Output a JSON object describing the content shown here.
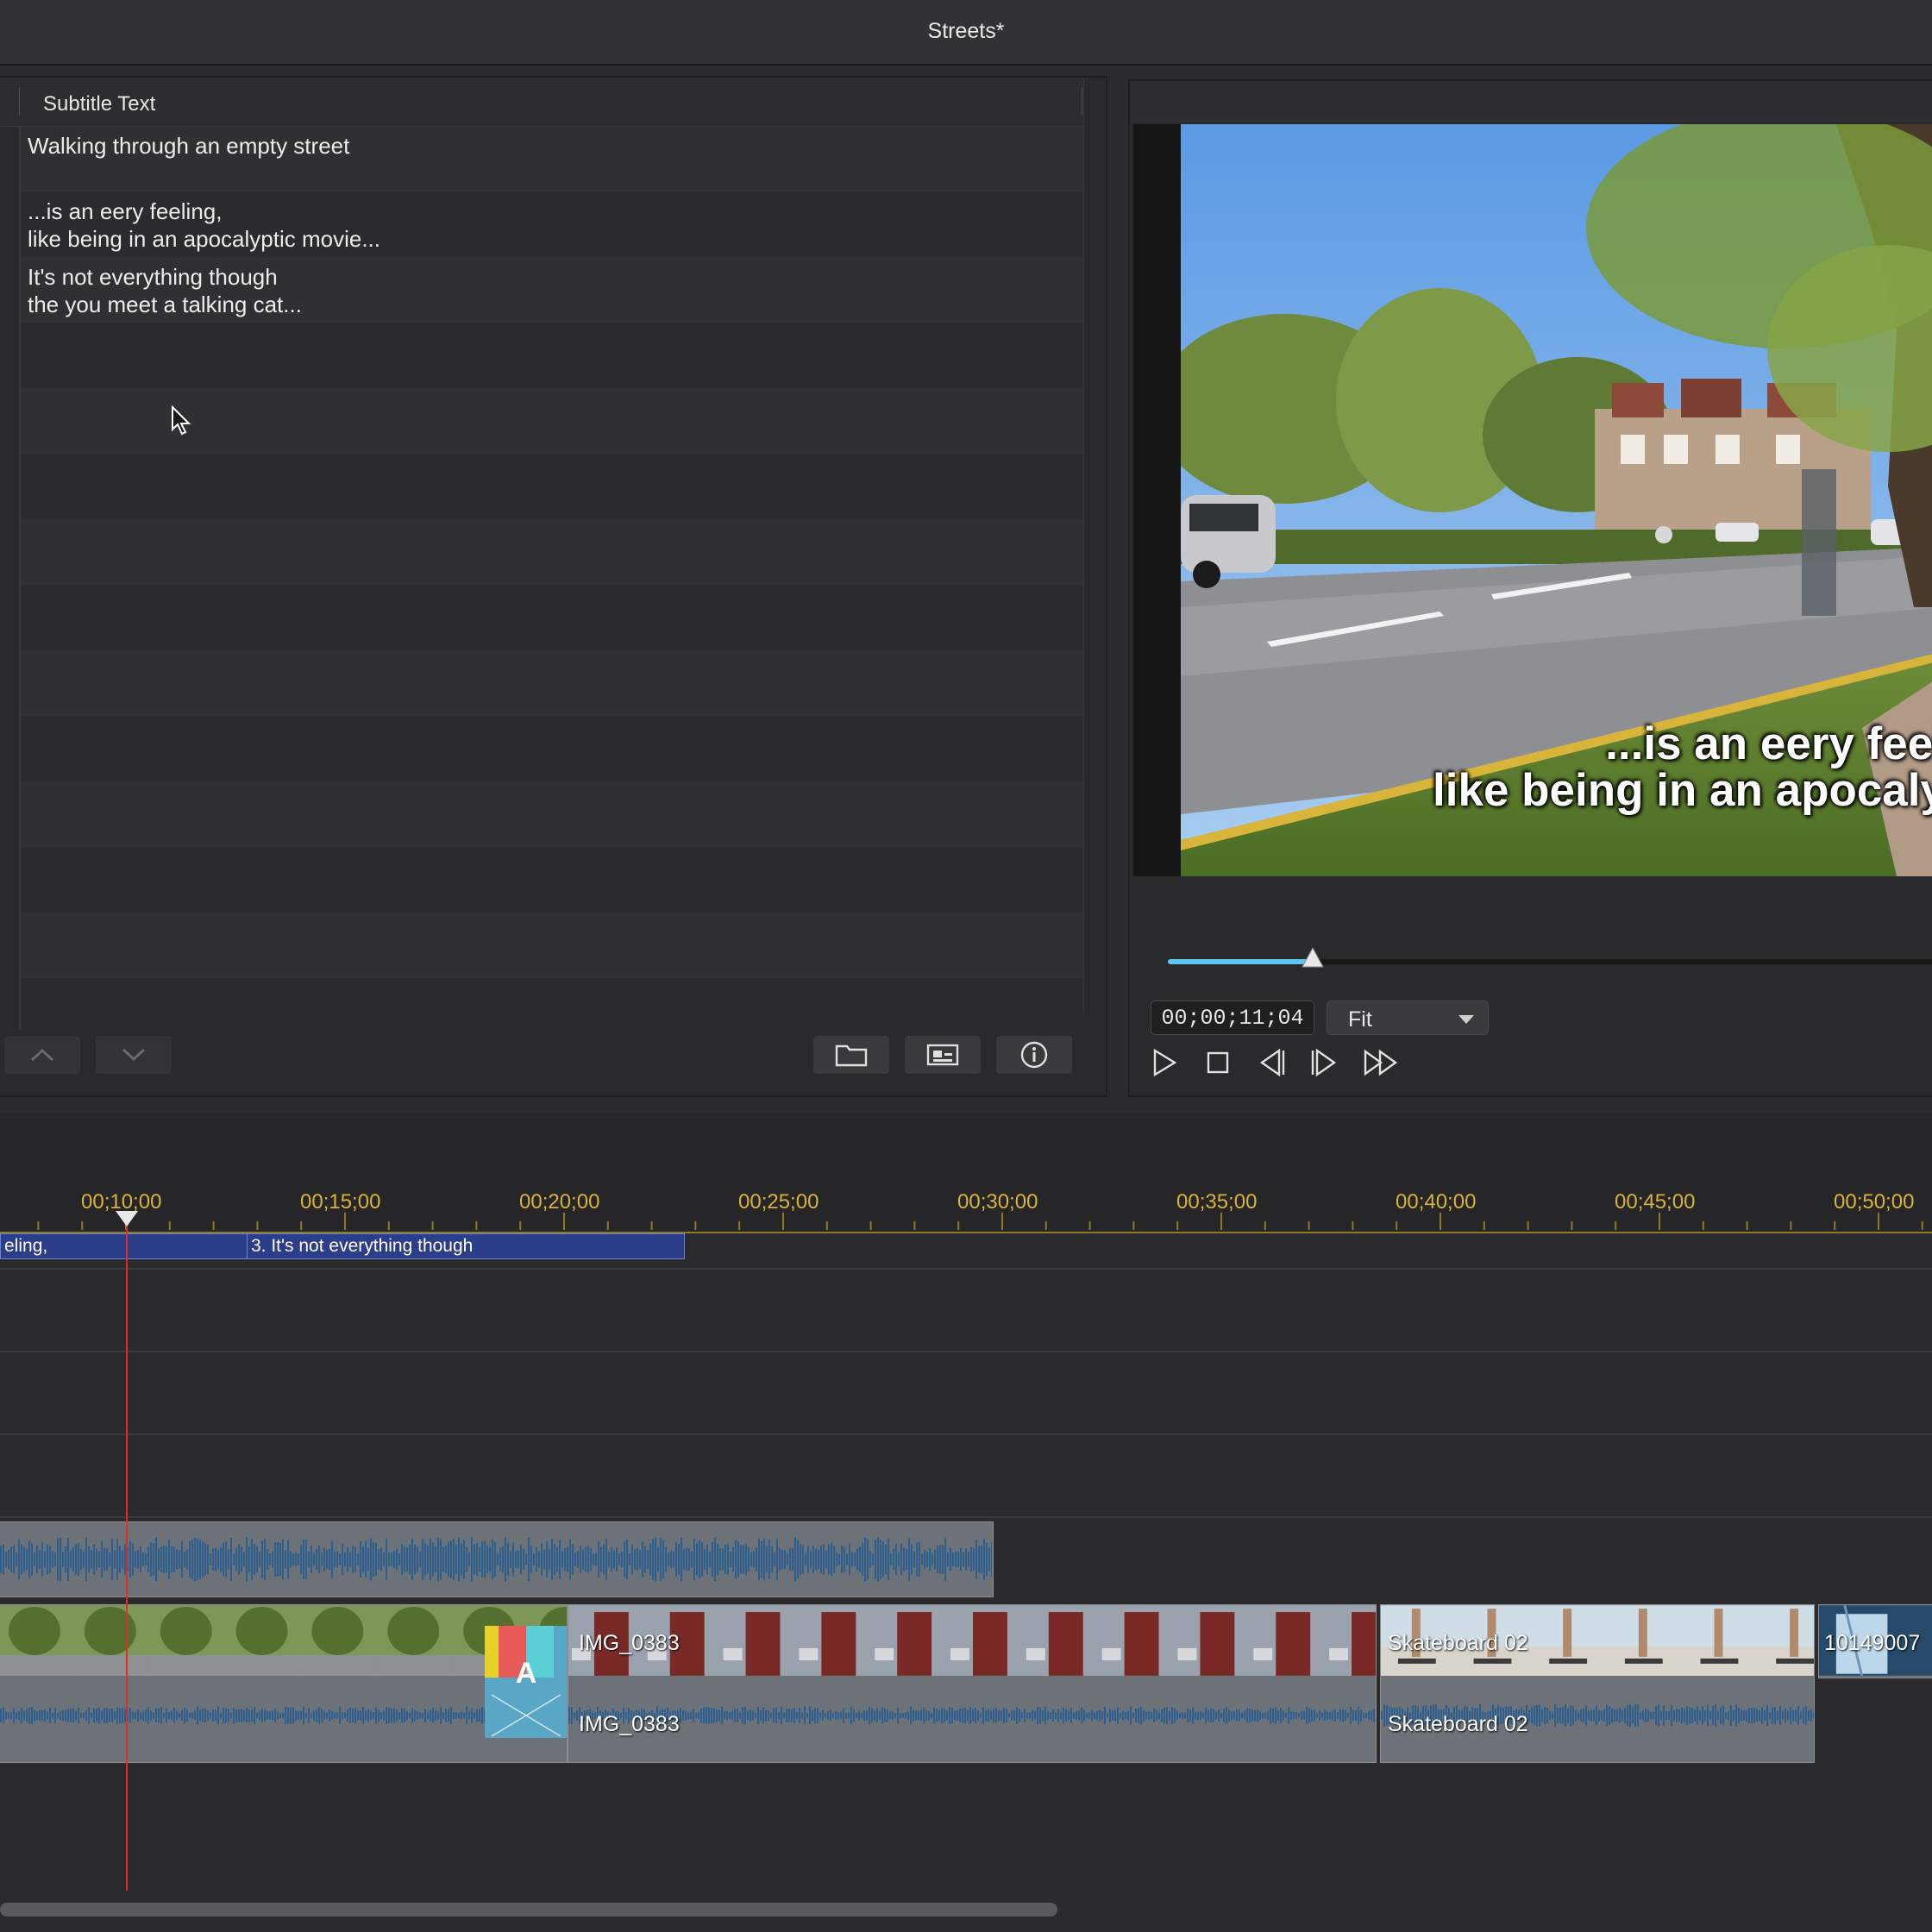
{
  "window": {
    "title": "Streets*"
  },
  "subtitle_panel": {
    "column_header": "Subtitle Text",
    "rows": [
      {
        "text": "Walking through an empty street"
      },
      {
        "text": "...is an eery feeling,\nlike being in an apocalyptic movie..."
      },
      {
        "text": "It's not everything though\nthe you meet a talking cat..."
      },
      {
        "text": ""
      },
      {
        "text": ""
      },
      {
        "text": ""
      },
      {
        "text": ""
      },
      {
        "text": ""
      },
      {
        "text": ""
      },
      {
        "text": ""
      },
      {
        "text": ""
      },
      {
        "text": ""
      },
      {
        "text": ""
      },
      {
        "text": ""
      }
    ],
    "toolbar": {
      "move_up": "chevron-up-icon",
      "move_down": "chevron-down-icon",
      "open": "folder-icon",
      "subtitle_settings": "subtitle-icon",
      "info": "info-icon"
    }
  },
  "preview": {
    "overlay_line1": "...is an eery feel",
    "overlay_line2": "like being in an apocaly",
    "playback_position": 0.187,
    "timecode": "00;00;11;04",
    "zoom": "Fit",
    "colors": {
      "scrub_fill": "#5ec6ee"
    }
  },
  "timeline": {
    "ruler_labels": [
      "00;10;00",
      "00;15;00",
      "00;20;00",
      "00;25;00",
      "00;30;00",
      "00;35;00",
      "00;40;00",
      "00;45;00",
      "00;50;00"
    ],
    "subtitle_clips": [
      {
        "label": "eling,"
      },
      {
        "label": "3. It's not everything though"
      }
    ],
    "video_clips": [
      {
        "video_label": "",
        "audio_label": ""
      },
      {
        "video_label": "IMG_0383",
        "audio_label": "IMG_0383"
      },
      {
        "video_label": "Skateboard 02",
        "audio_label": "Skateboard 02"
      },
      {
        "video_label": "10149007",
        "audio_label": ""
      }
    ],
    "colors": {
      "playhead": "#d9302a",
      "ruler": "#d9b23a",
      "subtitle_clip": "#2c3e8a"
    }
  }
}
